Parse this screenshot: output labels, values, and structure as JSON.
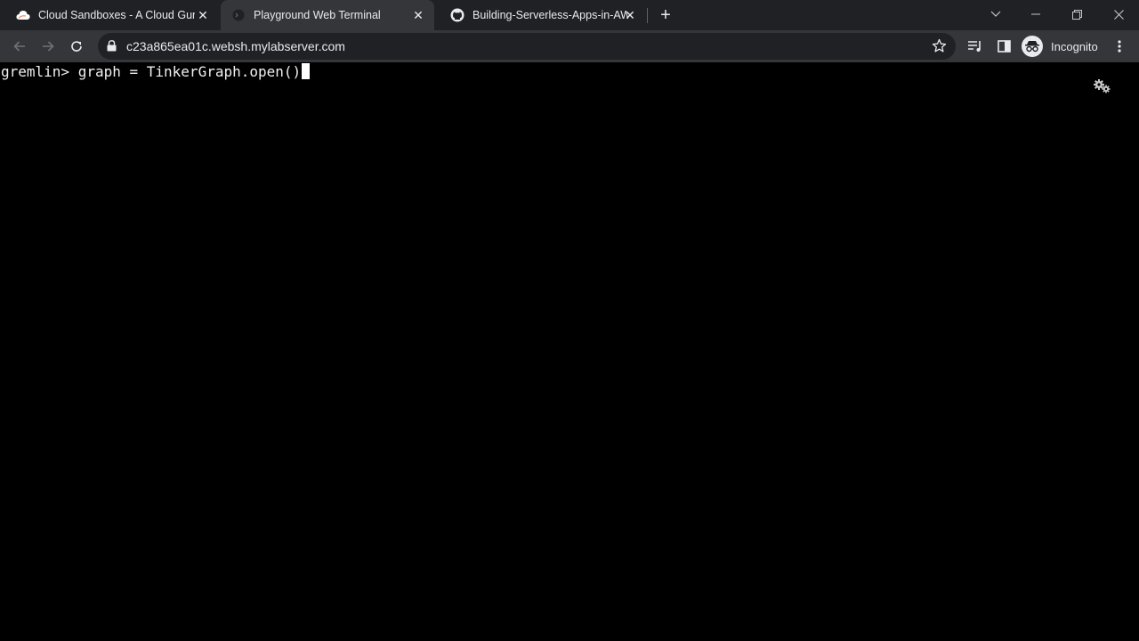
{
  "tabs": [
    {
      "title": "Cloud Sandboxes - A Cloud Guru",
      "favicon": "cloud-icon",
      "active": false
    },
    {
      "title": "Playground Web Terminal",
      "favicon": "terminal-icon",
      "active": true
    },
    {
      "title": "Building-Serverless-Apps-in-AWS",
      "favicon": "github-icon",
      "active": false
    }
  ],
  "omnibox": {
    "url": "c23a865ea01c.websh.mylabserver.com"
  },
  "profile": {
    "label": "Incognito"
  },
  "terminal": {
    "prompt": "gremlin>",
    "command": "graph = TinkerGraph.open()"
  },
  "colors": {
    "tabstrip": "#202124",
    "toolbar": "#35363a",
    "terminal_bg": "#000000"
  }
}
